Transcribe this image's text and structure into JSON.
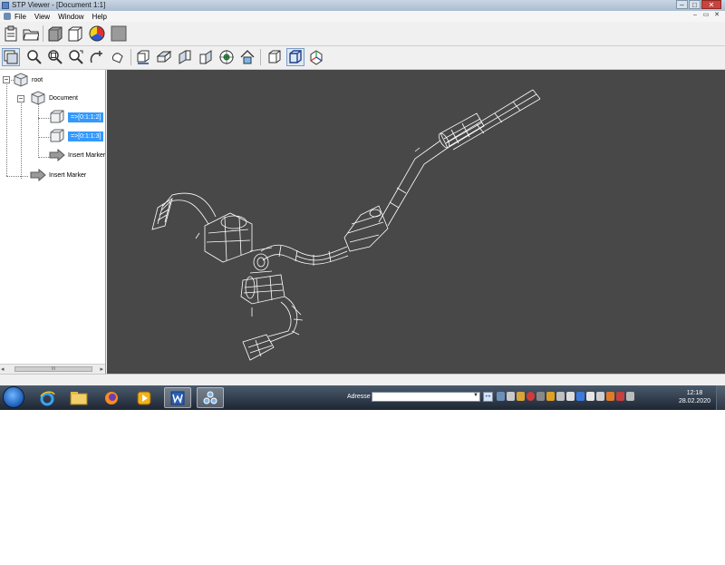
{
  "window": {
    "title": "STP Viewer - [Document 1:1]",
    "controls": {
      "minimize": "–",
      "maximize": "□",
      "close": "✕"
    }
  },
  "menubar": {
    "items": [
      "File",
      "View",
      "Window",
      "Help"
    ],
    "mdi_controls": [
      "–",
      "▭",
      "✕"
    ]
  },
  "toolbar1": {
    "buttons": [
      "paste-icon",
      "open-folder-icon",
      "shaded-box-icon",
      "wire-box-icon",
      "color-wheel-icon",
      "material-icon"
    ]
  },
  "toolbar2": {
    "buttons": [
      "select-icon",
      "zoom-icon",
      "zoom-window-icon",
      "zoom-fit-icon",
      "zoom-in-out-icon",
      "pan-icon",
      "view-front-icon",
      "view-top-icon",
      "view-left-icon",
      "view-right-icon",
      "view-axo-icon",
      "view-home-icon",
      "display-shaded-icon",
      "display-wireframe-icon",
      "display-axes-icon"
    ]
  },
  "tree": {
    "root": "root",
    "document": "Document",
    "shape1": "=>[0:1:1:2]",
    "shape2": "=>[0:1:1:3]",
    "marker_child": "Insert Marker",
    "marker_root": "Insert Marker"
  },
  "scrollbar": {
    "left": "◂",
    "right": "▸",
    "grip": "III"
  },
  "taskbar": {
    "address_label": "Adresse",
    "address_value": "",
    "time": "12:18",
    "date": "28.02.2020"
  },
  "colors": {
    "viewport_bg": "#484848",
    "wireframe": "#ffffff",
    "selection": "#3399ff"
  }
}
